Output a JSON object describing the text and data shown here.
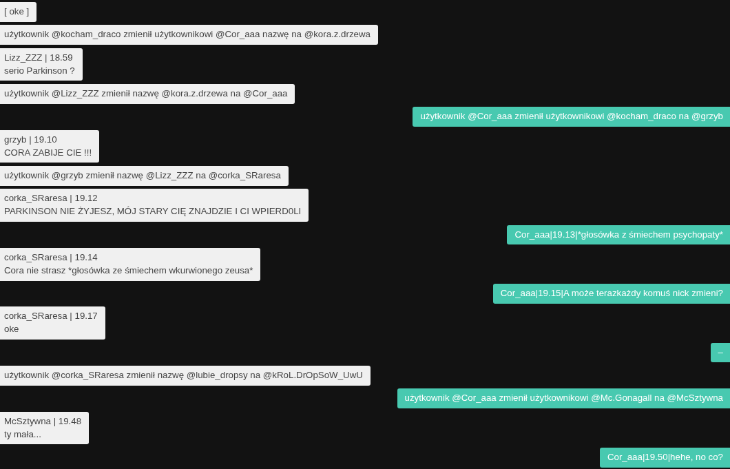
{
  "messages": [
    {
      "kind": "incoming",
      "text": "[ oke ]"
    },
    {
      "kind": "incoming",
      "text": "użytkownik @kocham_draco zmienił użytkownikowi @Cor_aaa nazwę na @kora.z.drzewa"
    },
    {
      "kind": "incoming",
      "header": "Lizz_ZZZ | 18.59",
      "text": "serio Parkinson ?"
    },
    {
      "kind": "incoming",
      "text": "użytkownik @Lizz_ZZZ zmienił nazwę @kora.z.drzewa na @Cor_aaa"
    },
    {
      "kind": "outgoing",
      "text": "użytkownik @Cor_aaa zmienił użytkownikowi @kocham_draco na @grzyb"
    },
    {
      "kind": "incoming",
      "header": "grzyb | 19.10",
      "text": "CORA ZABIJE CIE !!!"
    },
    {
      "kind": "incoming",
      "text": "użytkownik @grzyb zmienił nazwę @Lizz_ZZZ na @corka_SRaresa"
    },
    {
      "kind": "incoming",
      "header": "corka_SRaresa | 19.12",
      "text": "PARKINSON NIE ŻYJESZ, MÓJ STARY CIĘ ZNAJDZIE I CI WPIERD0LI"
    },
    {
      "kind": "outgoing",
      "text": "Cor_aaa|19.13|*głosówka z śmiechem psychopaty*"
    },
    {
      "kind": "incoming",
      "header": "corka_SRaresa | 19.14",
      "text": "Cora nie strasz *głosówka ze śmiechem wkurwionego zeusa*"
    },
    {
      "kind": "outgoing",
      "text": "Cor_aaa|19.15|A może terazkażdy komuś nick zmieni?"
    },
    {
      "kind": "incoming",
      "header": "corka_SRaresa | 19.17",
      "text": "oke"
    },
    {
      "kind": "outgoing",
      "text": "–"
    },
    {
      "kind": "incoming",
      "text": "użytkownik @corka_SRaresa zmienił nazwę @lubie_dropsy na @kRoL.DrOpSoW_UwU"
    },
    {
      "kind": "outgoing",
      "text": "użytkownik @Cor_aaa zmienił użytkownikowi @Mc.Gonagall na @McSztywna"
    },
    {
      "kind": "incoming",
      "header": "McSztywna | 19.48",
      "text": "ty mała..."
    },
    {
      "kind": "outgoing",
      "text": "Cor_aaa|19.50|hehe, no co?"
    }
  ]
}
